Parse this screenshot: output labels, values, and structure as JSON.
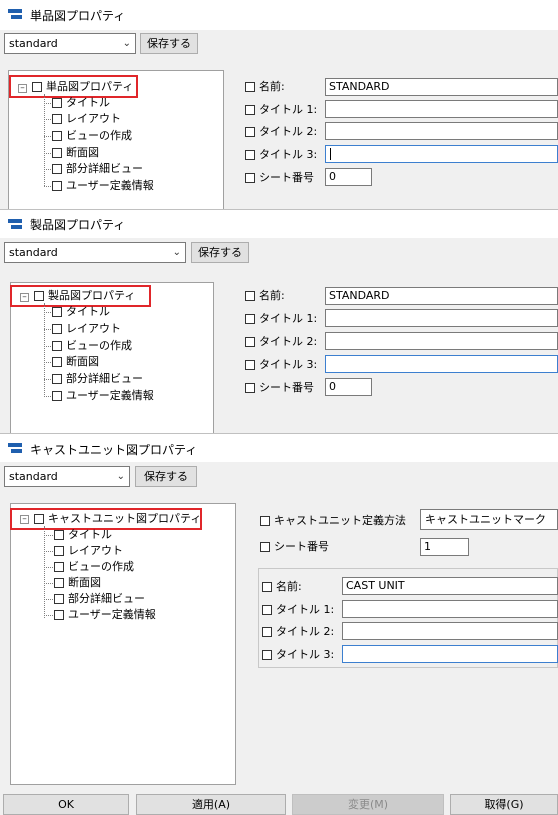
{
  "dialog1": {
    "title": "単品図プロパティ",
    "preset": "standard",
    "save_label": "保存する",
    "tree": {
      "root": "単品図プロパティ",
      "children": [
        "タイトル",
        "レイアウト",
        "ビューの作成",
        "断面図",
        "部分詳細ビュー",
        "ユーザー定義情報"
      ]
    },
    "fields": [
      {
        "label": "名前:",
        "value": "STANDARD"
      },
      {
        "label": "タイトル 1:",
        "value": ""
      },
      {
        "label": "タイトル 2:",
        "value": ""
      },
      {
        "label": "タイトル 3:",
        "value": ""
      },
      {
        "label": "シート番号",
        "value": "0"
      }
    ]
  },
  "dialog2": {
    "title": "製品図プロパティ",
    "preset": "standard",
    "save_label": "保存する",
    "tree": {
      "root": "製品図プロパティ",
      "children": [
        "タイトル",
        "レイアウト",
        "ビューの作成",
        "断面図",
        "部分詳細ビュー",
        "ユーザー定義情報"
      ]
    },
    "fields": [
      {
        "label": "名前:",
        "value": "STANDARD"
      },
      {
        "label": "タイトル 1:",
        "value": ""
      },
      {
        "label": "タイトル 2:",
        "value": ""
      },
      {
        "label": "タイトル 3:",
        "value": ""
      },
      {
        "label": "シート番号",
        "value": "0"
      }
    ]
  },
  "dialog3": {
    "title": "キャストユニット図プロパティ",
    "preset": "standard",
    "save_label": "保存する",
    "tree": {
      "root": "キャストユニット図プロパティ",
      "children": [
        "タイトル",
        "レイアウト",
        "ビューの作成",
        "断面図",
        "部分詳細ビュー",
        "ユーザー定義情報"
      ]
    },
    "definition_label": "キャストユニット定義方法",
    "definition_value": "キャストユニットマーク",
    "sheet_label": "シート番号",
    "sheet_value": "1",
    "fields": [
      {
        "label": "名前:",
        "value": "CAST UNIT"
      },
      {
        "label": "タイトル 1:",
        "value": ""
      },
      {
        "label": "タイトル 2:",
        "value": ""
      },
      {
        "label": "タイトル 3:",
        "value": ""
      }
    ]
  },
  "footer": {
    "ok": "OK",
    "apply": "適用(A)",
    "modify": "変更(M)",
    "get": "取得(G)"
  },
  "colors": {
    "highlight_box": "#e0262a",
    "focus_border": "#3c7fcf",
    "icon": "#1f5fae"
  }
}
